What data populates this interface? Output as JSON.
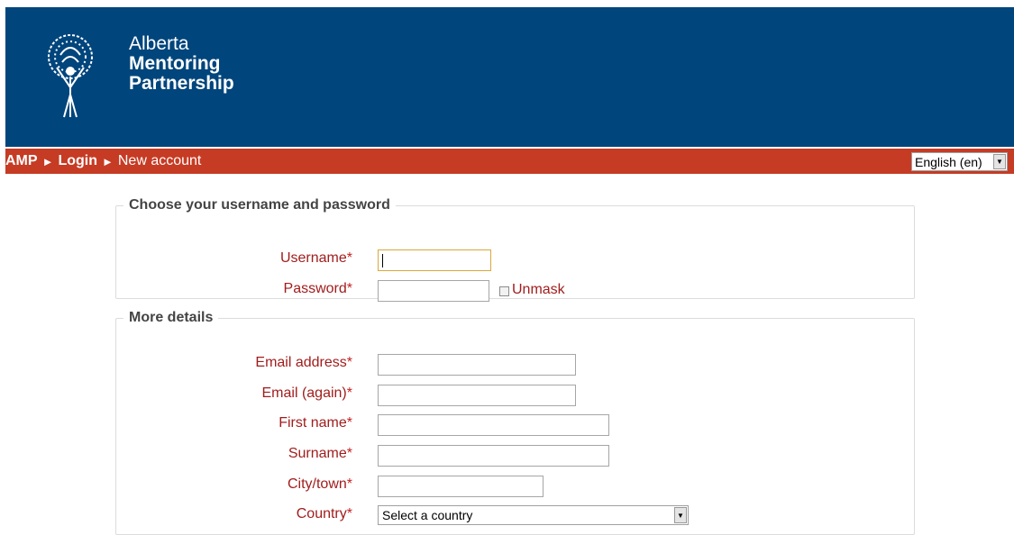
{
  "header": {
    "logo_line1": "Alberta",
    "logo_line2": "Mentoring",
    "logo_line3": "Partnership",
    "logo_icon": "tree-figure-icon",
    "bg_color": "#00457c"
  },
  "navbar": {
    "bg_color": "#c63b24",
    "breadcrumb": [
      {
        "label": "AMP"
      },
      {
        "label": "Login"
      },
      {
        "label": "New account"
      }
    ],
    "separator": "►",
    "language": "English (en)"
  },
  "sections": {
    "credentials": {
      "legend": "Choose your username and password",
      "username_label": "Username",
      "password_label": "Password",
      "required_mark": "*",
      "unmask_label": "Unmask",
      "username_value": "",
      "password_value": ""
    },
    "details": {
      "legend": "More details",
      "email_label": "Email address",
      "email_again_label": "Email (again)",
      "firstname_label": "First name",
      "surname_label": "Surname",
      "city_label": "City/town",
      "country_label": "Country",
      "required_mark": "*",
      "country_value": "Select a country"
    }
  }
}
